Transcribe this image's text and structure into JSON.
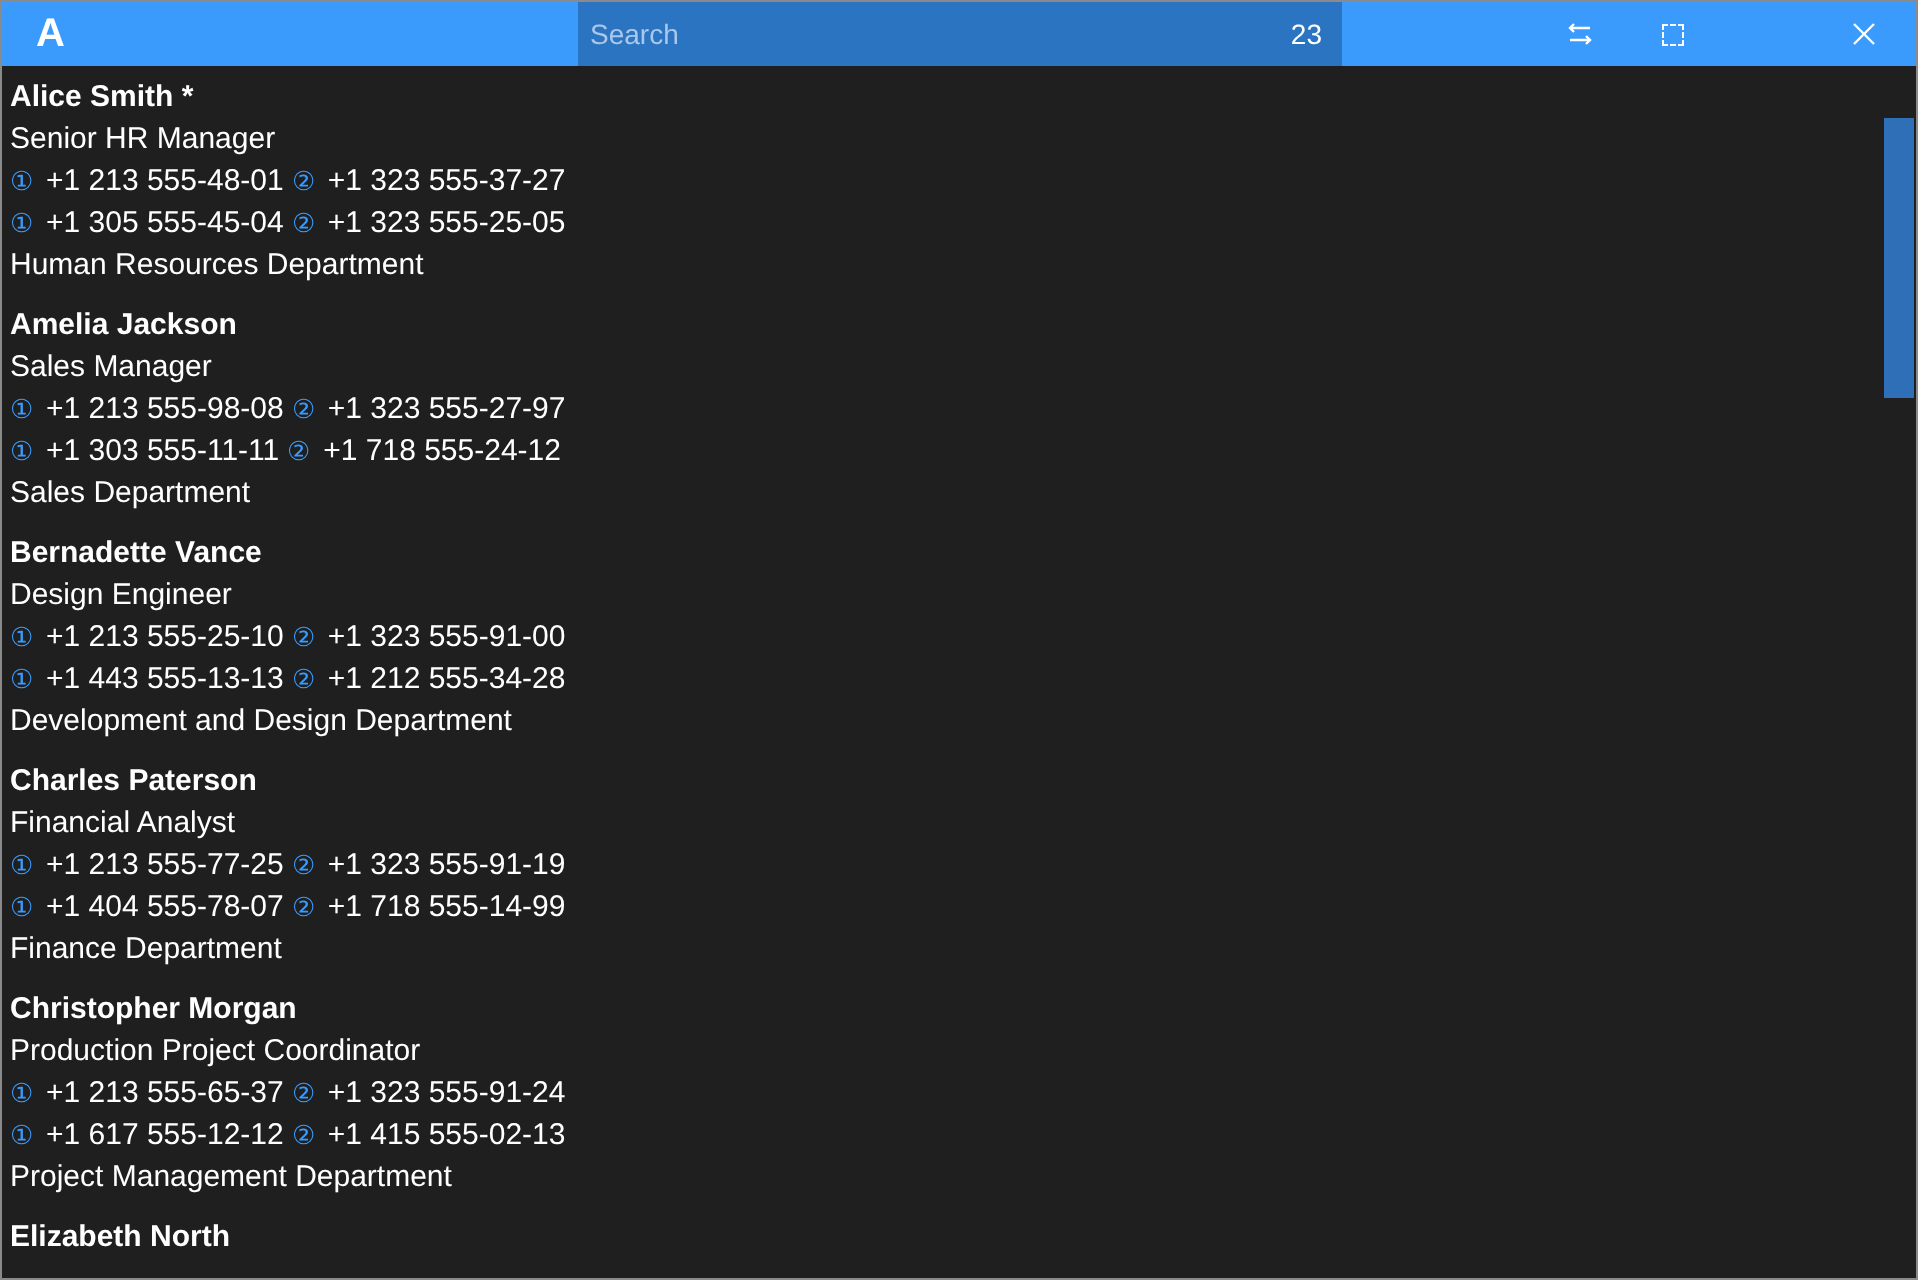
{
  "header": {
    "letter": "A",
    "search": {
      "placeholder": "Search",
      "count": "23"
    }
  },
  "contacts": [
    {
      "name": "Alice Smith *",
      "title": "Senior HR Manager",
      "phones": [
        [
          {
            "mark": "①",
            "number": "+1 213 555-48-01"
          },
          {
            "mark": "②",
            "number": "+1 323 555-37-27"
          }
        ],
        [
          {
            "mark": "①",
            "number": "+1 305 555-45-04"
          },
          {
            "mark": "②",
            "number": "+1 323 555-25-05"
          }
        ]
      ],
      "department": "Human Resources Department"
    },
    {
      "name": "Amelia Jackson",
      "title": "Sales Manager",
      "phones": [
        [
          {
            "mark": "①",
            "number": "+1 213 555-98-08"
          },
          {
            "mark": "②",
            "number": "+1 323 555-27-97"
          }
        ],
        [
          {
            "mark": "①",
            "number": "+1 303 555-11-11"
          },
          {
            "mark": "②",
            "number": "+1 718 555-24-12"
          }
        ]
      ],
      "department": "Sales Department"
    },
    {
      "name": "Bernadette Vance",
      "title": "Design Engineer",
      "phones": [
        [
          {
            "mark": "①",
            "number": "+1 213 555-25-10"
          },
          {
            "mark": "②",
            "number": "+1 323 555-91-00"
          }
        ],
        [
          {
            "mark": "①",
            "number": "+1 443 555-13-13"
          },
          {
            "mark": "②",
            "number": "+1 212 555-34-28"
          }
        ]
      ],
      "department": "Development and Design Department"
    },
    {
      "name": "Charles Paterson",
      "title": "Financial Analyst",
      "phones": [
        [
          {
            "mark": "①",
            "number": "+1 213 555-77-25"
          },
          {
            "mark": "②",
            "number": "+1 323 555-91-19"
          }
        ],
        [
          {
            "mark": "①",
            "number": "+1 404 555-78-07"
          },
          {
            "mark": "②",
            "number": "+1 718 555-14-99"
          }
        ]
      ],
      "department": "Finance Department"
    },
    {
      "name": "Christopher Morgan",
      "title": "Production Project Coordinator",
      "phones": [
        [
          {
            "mark": "①",
            "number": "+1 213 555-65-37"
          },
          {
            "mark": "②",
            "number": "+1 323 555-91-24"
          }
        ],
        [
          {
            "mark": "①",
            "number": "+1 617 555-12-12"
          },
          {
            "mark": "②",
            "number": "+1 415 555-02-13"
          }
        ]
      ],
      "department": "Project Management Department"
    },
    {
      "name": "Elizabeth North"
    }
  ]
}
